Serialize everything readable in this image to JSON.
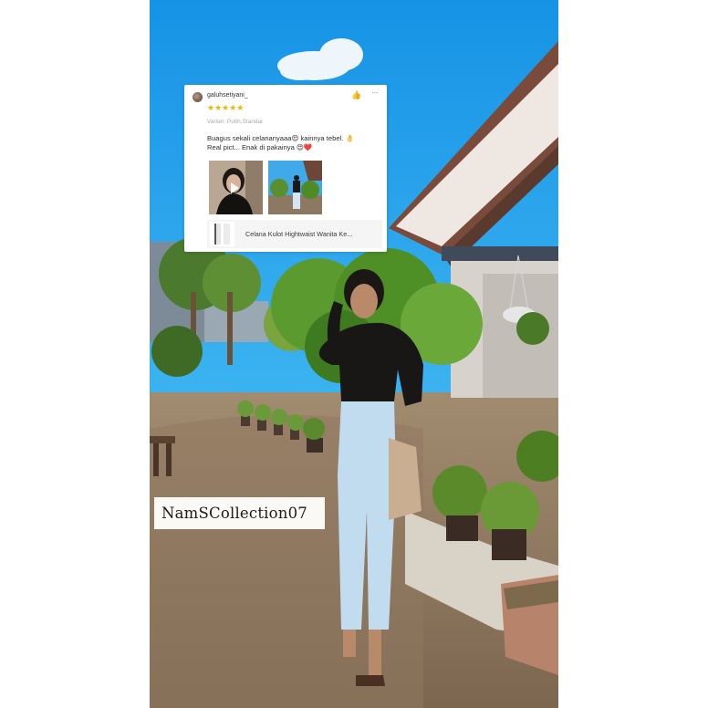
{
  "review": {
    "username": "galuhsetiyani_",
    "rating": 5,
    "stars": "★★★★★",
    "like_icon": "thumbs-up-icon",
    "more_icon": "more-icon",
    "more_glyph": "···",
    "variant": "Varian: Putih,Standar",
    "text_line1": "Buagus sekali celananyaaa😍 kainnya tebel. 👌",
    "text_line2": "Real pict... Enak di pakainya 😍❤️",
    "media": [
      {
        "kind": "video",
        "icon": "play-icon"
      },
      {
        "kind": "photo"
      }
    ],
    "product_name": "Celana Kulot Hightwaist Wanita Ke..."
  },
  "shop_label": "NamSCollection07",
  "colors": {
    "sky": "#1f9ee8",
    "star": "#f5b301",
    "roof": "#7a4a3a"
  }
}
